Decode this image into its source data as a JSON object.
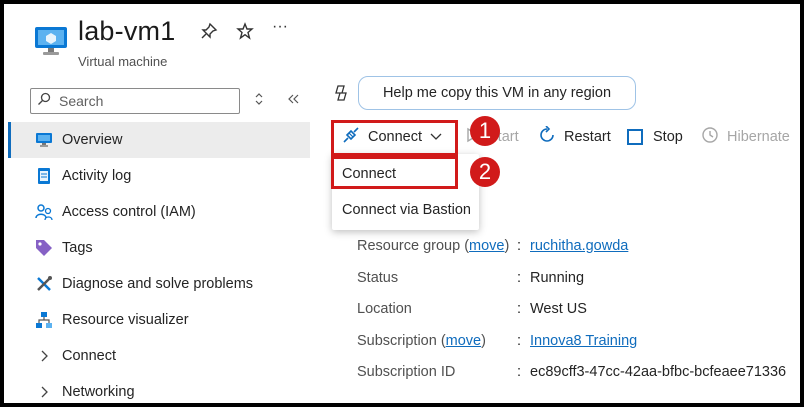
{
  "header": {
    "title": "lab-vm1",
    "subtitle": "Virtual machine",
    "pin_icon": "pin-icon",
    "favorite_icon": "star-icon",
    "more_label": "···"
  },
  "sidebar": {
    "search_placeholder": "Search",
    "items": [
      {
        "label": "Overview",
        "icon": "monitor-icon",
        "active": true
      },
      {
        "label": "Activity log",
        "icon": "log-icon"
      },
      {
        "label": "Access control (IAM)",
        "icon": "people-icon"
      },
      {
        "label": "Tags",
        "icon": "tag-icon"
      },
      {
        "label": "Diagnose and solve problems",
        "icon": "wrench-icon"
      },
      {
        "label": "Resource visualizer",
        "icon": "tree-icon"
      },
      {
        "label": "Connect",
        "icon": "chevron-right-icon"
      },
      {
        "label": "Networking",
        "icon": "chevron-right-icon"
      }
    ]
  },
  "copilot": {
    "prompt": "Help me copy this VM in any region"
  },
  "toolbar": {
    "connect": "Connect",
    "start": "Start",
    "restart": "Restart",
    "stop": "Stop",
    "hibernate": "Hibernate"
  },
  "connect_menu": {
    "items": [
      "Connect",
      "Connect via Bastion"
    ]
  },
  "annotations": {
    "badge1": "1",
    "badge2": "2",
    "color": "#d11a1a"
  },
  "essentials": {
    "resource_group_label": "Resource group",
    "move_label": "move",
    "resource_group_value": "ruchitha.gowda",
    "status_label": "Status",
    "status_value": "Running",
    "location_label": "Location",
    "location_value": "West US",
    "subscription_label": "Subscription",
    "subscription_value": "Innova8 Training",
    "subscription_id_label": "Subscription ID",
    "subscription_id_value": "ec89cff3-47cc-42aa-bfbc-bcfeaee71336",
    "colon": ":"
  },
  "colors": {
    "accent": "#0f6cbd",
    "annotation": "#d11a1a"
  }
}
